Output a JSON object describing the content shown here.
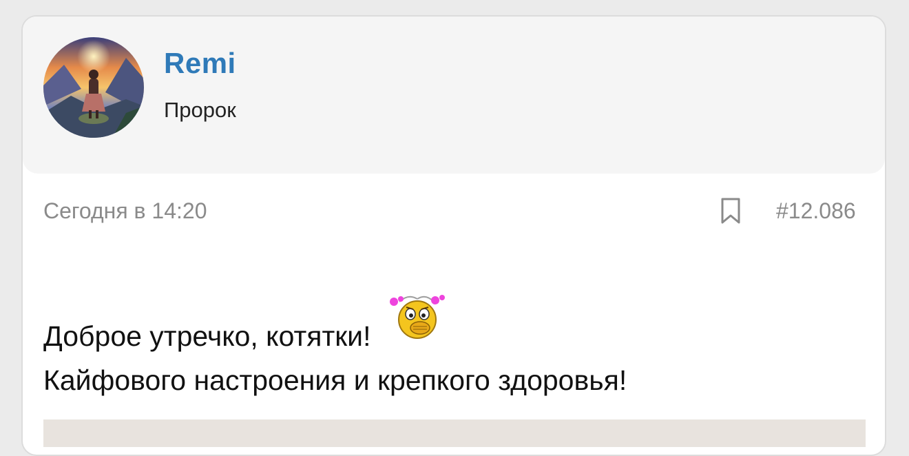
{
  "user": {
    "name": "Remi",
    "title": "Пророк"
  },
  "post": {
    "date": "Сегодня в 14:20",
    "number": "#12.086",
    "lines": [
      "Доброе утречко, котятки!",
      "Кайфового настроения и крепкого здоровья!"
    ]
  },
  "icons": {
    "bookmark": "bookmark-icon",
    "smiley": "smiley-hand-over-mouth-icon"
  },
  "colors": {
    "username": "#2f7ab8",
    "meta_text": "#8a8a8a",
    "header_bg": "#f5f5f5",
    "page_bg": "#ebebeb"
  }
}
